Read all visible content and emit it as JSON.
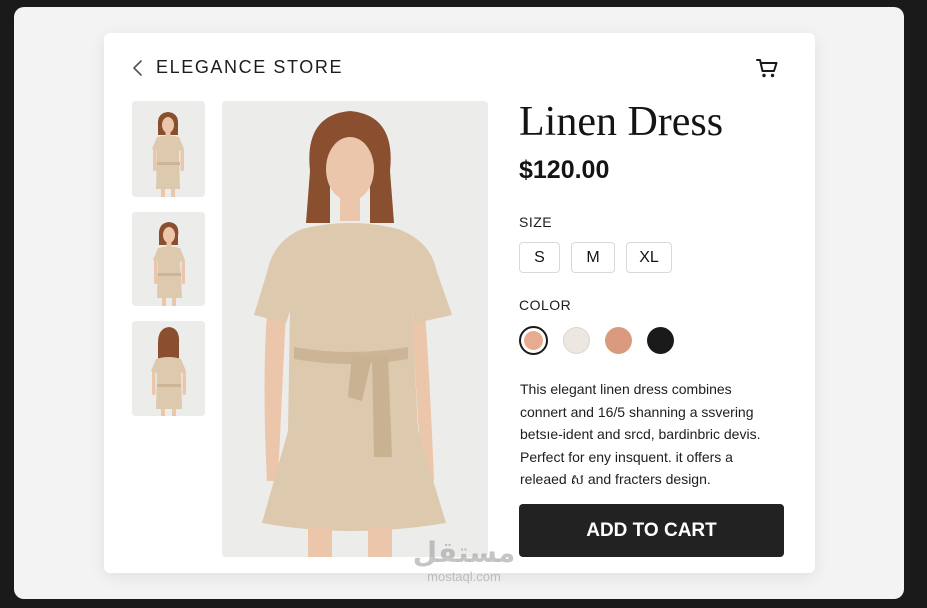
{
  "header": {
    "store_name": "ELEGANCE STORE",
    "back_icon": "chevron-left-icon",
    "cart_icon": "cart-icon"
  },
  "gallery": {
    "thumbnails": [
      {
        "view": "front"
      },
      {
        "view": "angled"
      },
      {
        "view": "back"
      }
    ]
  },
  "product": {
    "name": "Linen Dress",
    "price": "$120.00",
    "size_label": "SIZE",
    "sizes": [
      "S",
      "M",
      "XL"
    ],
    "color_label": "COLOR",
    "colors": [
      {
        "hex": "#e8ab90",
        "selected": true
      },
      {
        "hex": "#ece7e0",
        "selected": false
      },
      {
        "hex": "#da9a80",
        "selected": false
      },
      {
        "hex": "#1a1a1a",
        "selected": false
      }
    ],
    "description_lines": [
      "This elegant linen dress combines",
      "connert and 16/5 shanning a ssvering",
      "betsıe-ident and srcd, bardinbric devis.",
      "Perfect for eny insquent. it offers a",
      "releaed ស and fracters design."
    ],
    "add_to_cart_label": "ADD TO CART"
  },
  "watermark": {
    "arabic": "مستقل",
    "latin": "mostaql.com"
  },
  "theme": {
    "dress_color": "#dcc9ae",
    "hair_color": "#8a4f2e",
    "skin_color": "#ecc6aa",
    "button_color": "#222222"
  }
}
